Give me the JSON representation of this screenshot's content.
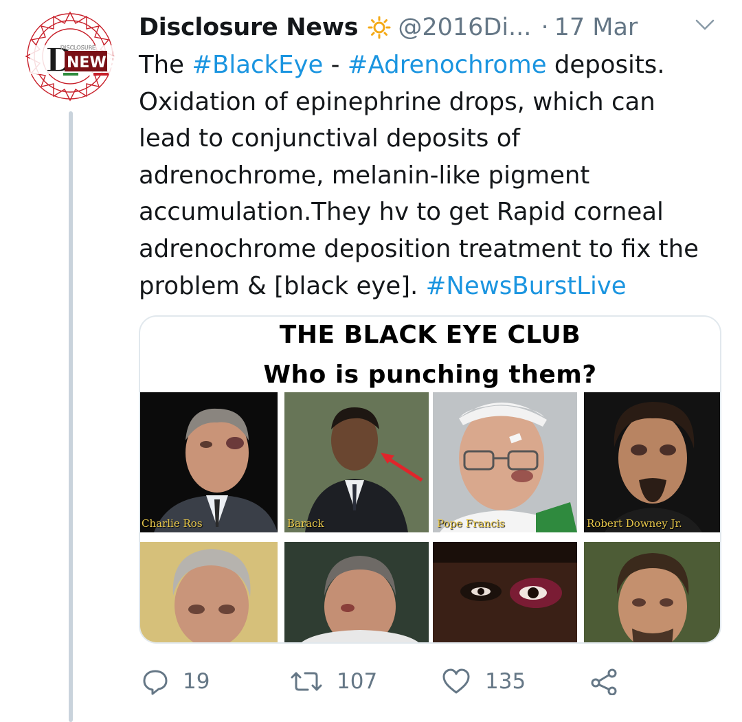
{
  "tweet": {
    "author": {
      "display_name": "Disclosure News",
      "badge_icon": "sun-icon",
      "handle": "@2016Di...",
      "avatar_text": "DISCLOSURE NEWS",
      "avatar_letter": "D"
    },
    "separator": "·",
    "time": "17 Mar",
    "text_lines": [
      [
        {
          "t": "The "
        },
        {
          "t": "#BlackEye",
          "tag": true
        },
        {
          "t": " - "
        },
        {
          "t": "#Adrenochrome",
          "tag": true
        },
        {
          "t": " deposits."
        }
      ],
      [
        {
          "t": "Oxidation of epinephrine drops, which can"
        }
      ],
      [
        {
          "t": "lead to conjunctival deposits of"
        }
      ],
      [
        {
          "t": "adrenochrome, melanin-like pigment"
        }
      ],
      [
        {
          "t": "accumulation.They hv to get Rapid corneal"
        }
      ],
      [
        {
          "t": "adrenochrome deposition treatment to fix the"
        }
      ],
      [
        {
          "t": "problem & [black eye]. "
        },
        {
          "t": "#NewsBurstLive",
          "tag": true
        }
      ]
    ],
    "hashtag_color": "#1b95e0",
    "media": {
      "title_line1": "THE BLACK EYE CLUB",
      "title_line2": "Who is punching them?",
      "captions": [
        "Charlie Ros",
        "Barack",
        "Pope Francis",
        "Robert Downey Jr."
      ]
    },
    "actions": {
      "reply": {
        "icon": "reply-icon",
        "count": "19"
      },
      "retweet": {
        "icon": "retweet-icon",
        "count": "107"
      },
      "like": {
        "icon": "heart-icon",
        "count": "135"
      },
      "share": {
        "icon": "share-icon"
      }
    }
  }
}
